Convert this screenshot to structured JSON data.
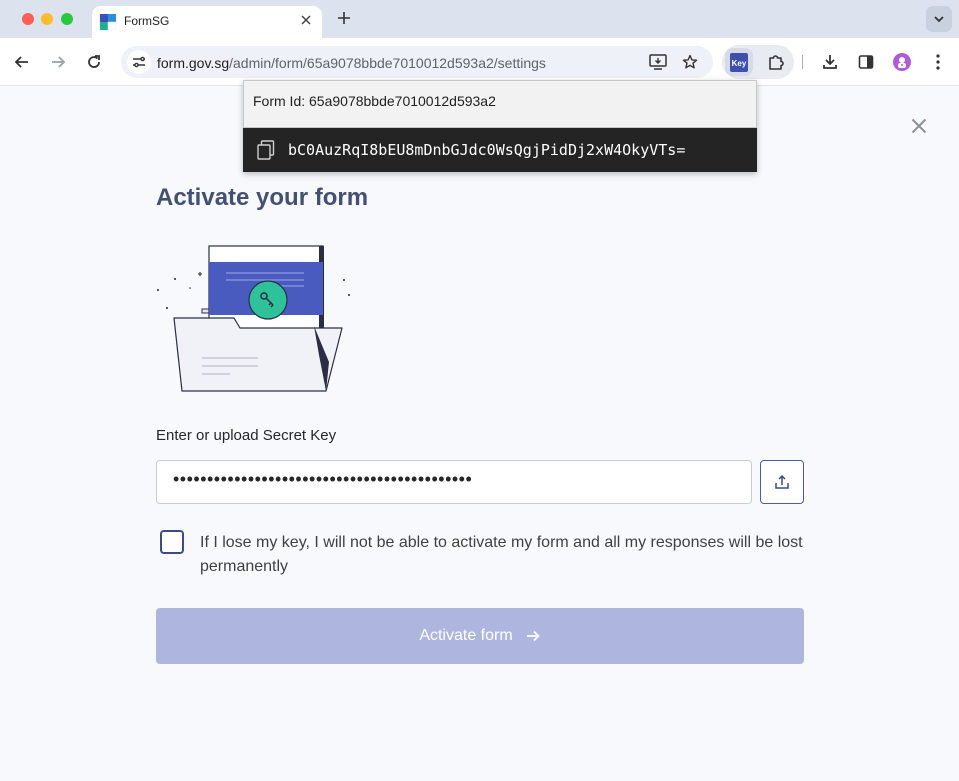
{
  "browser": {
    "tab_title": "FormSG",
    "url_domain": "form.gov.sg",
    "url_path": "/admin/form/65a9078bbde7010012d593a2/settings",
    "extension_label": "Key"
  },
  "popup": {
    "form_id": "Form Id: 65a9078bbde7010012d593a2",
    "secret_key": "bC0AuzRqI8bEU8mDnbGJdc0WsQgjPidDj2xW4OkyVTs="
  },
  "main": {
    "title": "Activate your form",
    "key_label": "Enter or upload Secret Key",
    "key_value": "••••••••••••••••••••••••••••••••••••••••••••",
    "ack_text": "If I lose my key, I will not be able to activate my form and all my responses will be lost permanently",
    "ack_checked": false,
    "activate_label": "Activate form"
  },
  "colors": {
    "title": "#445072",
    "primary_disabled": "#aeb6e0",
    "checkbox_border": "#3d4a88",
    "popup_bg": "#242424",
    "illustration_accent": "#4a5bc0",
    "key_badge": "#2ec19a"
  },
  "icons": {
    "back": "arrow-left-icon",
    "forward": "arrow-right-icon",
    "reload": "reload-icon",
    "site_settings": "tune-icon",
    "install": "install-app-icon",
    "bookmark": "star-icon",
    "extensions": "puzzle-icon",
    "download": "download-icon",
    "side_panel": "side-panel-icon",
    "menu": "kebab-menu-icon",
    "copy": "copy-icon",
    "close": "close-icon",
    "upload": "upload-icon",
    "activate_arrow": "arrow-right-icon"
  }
}
